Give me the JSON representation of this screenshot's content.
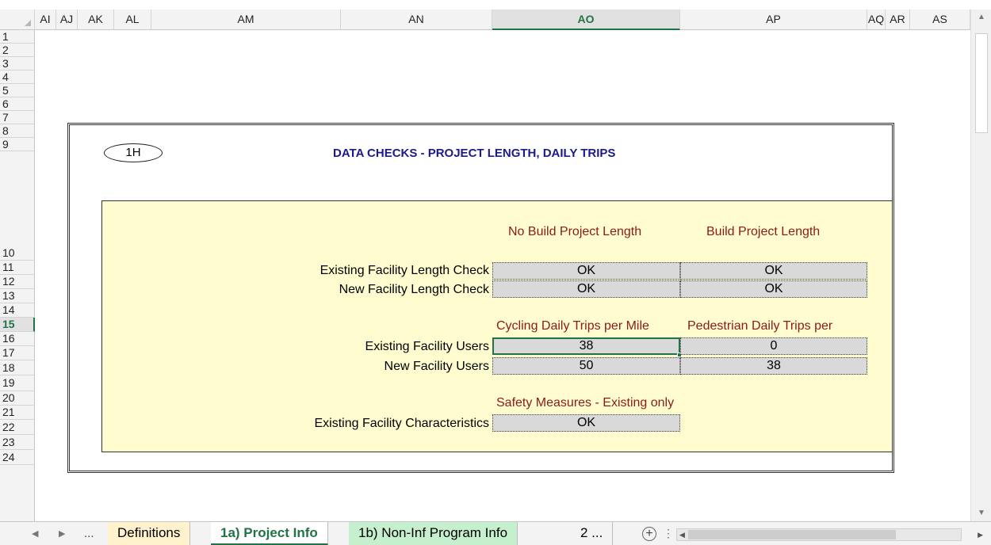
{
  "columns": [
    "AI",
    "AJ",
    "AK",
    "AL",
    "AM",
    "AN",
    "AO",
    "AP",
    "AQ",
    "AR",
    "AS"
  ],
  "active_column": "AO",
  "rows": [
    "1",
    "2",
    "3",
    "4",
    "5",
    "6",
    "7",
    "8",
    "9",
    "10",
    "11",
    "12",
    "13",
    "14",
    "15",
    "16",
    "17",
    "18",
    "19",
    "20",
    "21",
    "22",
    "23",
    "24"
  ],
  "active_row": "15",
  "sheet": {
    "badge": "1H",
    "title": "DATA CHECKS - PROJECT LENGTH, DAILY TRIPS",
    "length_section": {
      "col1_header": "No Build Project Length",
      "col2_header": "Build Project Length",
      "rows": [
        {
          "label": "Existing Facility Length Check",
          "v1": "OK",
          "v2": "OK"
        },
        {
          "label": "New Facility Length Check",
          "v1": "OK",
          "v2": "OK"
        }
      ]
    },
    "trips_section": {
      "col1_header": "Cycling Daily Trips per Mile",
      "col2_header": "Pedestrian Daily Trips per",
      "rows": [
        {
          "label": "Existing Facility Users",
          "v1": "38",
          "v2": "0"
        },
        {
          "label": "New Facility Users",
          "v1": "50",
          "v2": "38"
        }
      ]
    },
    "safety_section": {
      "header": "Safety Measures - Existing only",
      "label": "Existing Facility Characteristics",
      "value": "OK"
    }
  },
  "tabs": {
    "prev_arrow": "◀",
    "next_arrow": "▶",
    "ellipsis": "...",
    "items": [
      "Definitions",
      "1a) Project Info",
      "1b) Non-Inf Program Info",
      "2 ..."
    ],
    "active_tab": "1a) Project Info",
    "add_sheet": "+",
    "separator": "⋮"
  },
  "colors": {
    "accent": "#217346",
    "title": "#1a1a8c",
    "header_red": "#8b1a1a",
    "panel": "#fffdcf",
    "value_fill": "#d9d9d9"
  }
}
